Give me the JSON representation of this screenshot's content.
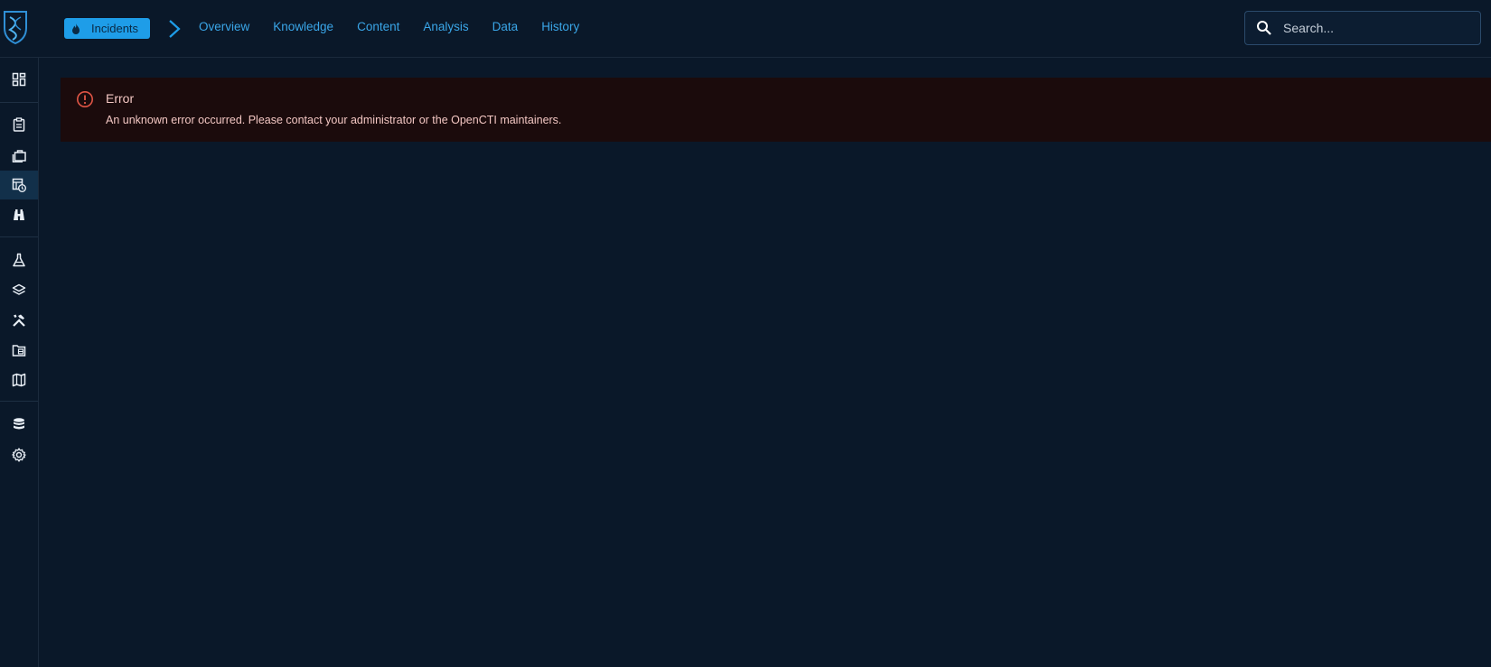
{
  "app": {
    "logo_icon": "opencti-logo-icon"
  },
  "header": {
    "section_label": "Incidents",
    "section_icon": "fire-icon",
    "nav": [
      {
        "label": "Overview"
      },
      {
        "label": "Knowledge"
      },
      {
        "label": "Content"
      },
      {
        "label": "Analysis"
      },
      {
        "label": "Data"
      },
      {
        "label": "History"
      }
    ],
    "search": {
      "placeholder": "Search..."
    }
  },
  "sidebar": {
    "items": [
      {
        "icon": "dashboard-icon"
      },
      {
        "icon": "analyses-icon"
      },
      {
        "icon": "cases-icon"
      },
      {
        "icon": "events-icon",
        "active": true
      },
      {
        "icon": "observations-icon"
      },
      {
        "icon": "threats-icon"
      },
      {
        "icon": "arsenal-icon"
      },
      {
        "icon": "techniques-icon"
      },
      {
        "icon": "entities-icon"
      },
      {
        "icon": "locations-icon"
      },
      {
        "icon": "data-icon"
      },
      {
        "icon": "settings-icon"
      }
    ]
  },
  "error": {
    "title": "Error",
    "message": "An unknown error occurred. Please contact your administrator or the OpenCTI maintainers.",
    "icon": "error-icon"
  },
  "colors": {
    "accent": "#1e9de8",
    "nav_link": "#3aa6e8",
    "background": "#0a1829",
    "error_bg": "#1b0b0c",
    "error_text": "#f2c6c2",
    "error_icon": "#e05545"
  }
}
